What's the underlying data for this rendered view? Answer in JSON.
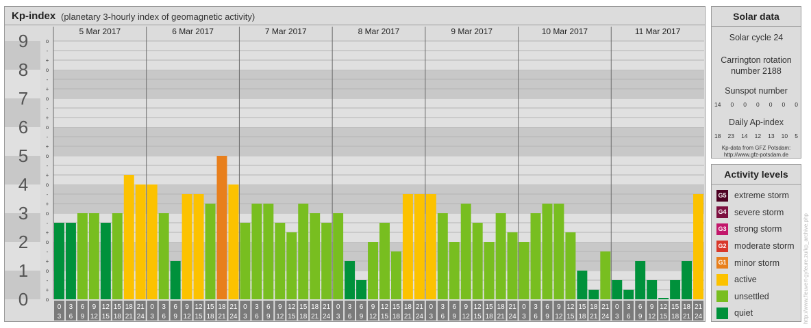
{
  "header": {
    "title": "Kp-index",
    "subtitle": "(planetary 3-hourly index of geomagnetic activity)"
  },
  "chart_data": {
    "type": "bar",
    "title": "Kp-index",
    "subtitle": "(planetary 3-hourly index of geomagnetic activity)",
    "ylim": [
      0,
      9
    ],
    "y_ticks": [
      "0",
      "1",
      "2",
      "3",
      "4",
      "5",
      "6",
      "7",
      "8",
      "9"
    ],
    "sub_ticks": [
      "o",
      "+",
      "-"
    ],
    "days": [
      "5 Mar 2017",
      "6 Mar 2017",
      "7 Mar 2017",
      "8 Mar 2017",
      "9 Mar 2017",
      "10 Mar 2017",
      "11 Mar 2017"
    ],
    "interval_start": [
      "0",
      "3",
      "6",
      "9",
      "12",
      "15",
      "18",
      "21"
    ],
    "interval_end": [
      "3",
      "6",
      "9",
      "12",
      "15",
      "18",
      "21",
      "24"
    ],
    "values": [
      2.667,
      2.667,
      3.0,
      3.0,
      2.667,
      3.0,
      4.333,
      4.0,
      4.0,
      3.0,
      1.333,
      3.667,
      3.667,
      3.333,
      5.0,
      4.0,
      2.667,
      3.333,
      3.333,
      2.667,
      2.333,
      3.333,
      3.0,
      2.667,
      3.0,
      1.333,
      0.667,
      2.0,
      2.667,
      1.667,
      3.667,
      3.667,
      3.667,
      3.0,
      2.0,
      3.333,
      2.667,
      2.0,
      3.0,
      2.333,
      2.0,
      3.0,
      3.333,
      3.333,
      2.333,
      1.0,
      0.333,
      1.667,
      0.667,
      0.333,
      1.333,
      0.667,
      0.0,
      0.667,
      1.333,
      3.667
    ],
    "levels": [
      "quiet",
      "quiet",
      "unsettled",
      "unsettled",
      "quiet",
      "unsettled",
      "active",
      "active",
      "active",
      "unsettled",
      "quiet",
      "active",
      "active",
      "unsettled",
      "moderate-storm",
      "active",
      "unsettled",
      "unsettled",
      "unsettled",
      "unsettled",
      "unsettled",
      "unsettled",
      "unsettled",
      "unsettled",
      "unsettled",
      "quiet",
      "quiet",
      "unsettled",
      "unsettled",
      "unsettled",
      "active",
      "active",
      "active",
      "unsettled",
      "unsettled",
      "unsettled",
      "unsettled",
      "unsettled",
      "unsettled",
      "unsettled",
      "unsettled",
      "unsettled",
      "unsettled",
      "unsettled",
      "unsettled",
      "quiet",
      "quiet",
      "unsettled",
      "quiet",
      "quiet",
      "quiet",
      "quiet",
      "quiet",
      "quiet",
      "quiet",
      "active"
    ],
    "grid": true
  },
  "colors": {
    "quiet": "#00913b",
    "unsettled": "#78be20",
    "active": "#fcc200",
    "minor-storm": "#e87f1c",
    "moderate-storm": "#e87f1c",
    "moderate-storm-g": "#d9382a",
    "strong-storm": "#c2176b",
    "severe-storm": "#7d1040",
    "extreme-storm": "#4d0022",
    "band-dark": "#c8c8c8",
    "band-light": "#e0e0e0"
  },
  "solar": {
    "title": "Solar data",
    "cycle": "Solar cycle 24",
    "carrington": "Carrington rotation number 2188",
    "sunspot_label": "Sunspot number",
    "sunspot_values": [
      "14",
      "0",
      "0",
      "0",
      "0",
      "0",
      "0"
    ],
    "ap_label": "Daily Ap-index",
    "ap_values": [
      "18",
      "23",
      "14",
      "12",
      "13",
      "10",
      "5"
    ],
    "credit_line1": "Kp-data from GFZ Potsdam:",
    "credit_line2": "http://www.gfz-potsdam.de"
  },
  "activity": {
    "title": "Activity levels",
    "items": [
      {
        "code": "G5",
        "label": "extreme storm",
        "color": "#4d0022"
      },
      {
        "code": "G4",
        "label": "severe storm",
        "color": "#7d1040"
      },
      {
        "code": "G3",
        "label": "strong storm",
        "color": "#c2176b"
      },
      {
        "code": "G2",
        "label": "moderate storm",
        "color": "#d9382a"
      },
      {
        "code": "G1",
        "label": "minor storm",
        "color": "#e87f1c"
      },
      {
        "code": "",
        "label": "active",
        "color": "#fcc200"
      },
      {
        "code": "",
        "label": "unsettled",
        "color": "#78be20"
      },
      {
        "code": "",
        "label": "quiet",
        "color": "#00913b"
      }
    ]
  },
  "watermark": "http://www.fleuvert-gyfeure.zu/kp_archive.php"
}
